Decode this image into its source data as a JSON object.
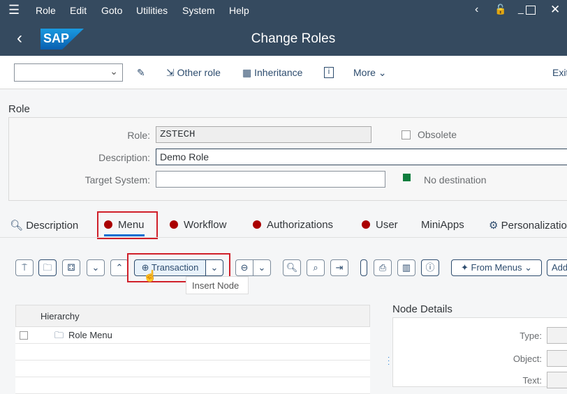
{
  "menu": {
    "items": [
      "Role",
      "Edit",
      "Goto",
      "Utilities",
      "System",
      "Help"
    ]
  },
  "title": "Change Roles",
  "logo": "SAP",
  "toolbar": {
    "other_role": "Other role",
    "inheritance": "Inheritance",
    "more": "More",
    "exit": "Exit"
  },
  "section_title": "Role",
  "form": {
    "role_label": "Role:",
    "role_value": "ZSTECH",
    "obsolete_label": "Obsolete",
    "description_label": "Description:",
    "description_value": "Demo Role",
    "target_label": "Target System:",
    "target_value": "",
    "destination_status": "No destination",
    "status_color": "#107e3e"
  },
  "tabs": [
    {
      "label": "Description"
    },
    {
      "label": "Menu"
    },
    {
      "label": "Workflow"
    },
    {
      "label": "Authorizations"
    },
    {
      "label": "User"
    },
    {
      "label": "MiniApps"
    },
    {
      "label": "Personalization"
    }
  ],
  "menu_toolbar": {
    "transaction": "Transaction",
    "tooltip": "Insert Node",
    "from_menus": "From Menus",
    "add": "Add"
  },
  "tree": {
    "header": "Hierarchy",
    "rows": [
      "Role Menu"
    ]
  },
  "node_details": {
    "title": "Node Details",
    "type_label": "Type:",
    "object_label": "Object:",
    "text_label": "Text:"
  }
}
